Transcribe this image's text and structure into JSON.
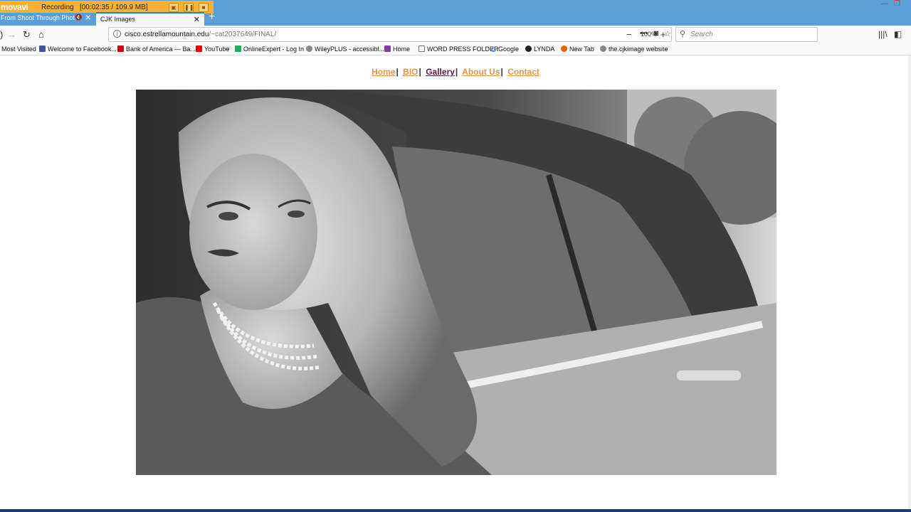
{
  "recorder": {
    "logo": "movavi",
    "status": "Recording",
    "time": "[00:02:35 / 109.9 MB]"
  },
  "tabs": [
    {
      "label": "From Shoot Through Photo",
      "active": false
    },
    {
      "label": "CJK Images",
      "active": true
    }
  ],
  "urlbar": {
    "host": "cisco.estrellamountain.edu",
    "path": "/~cat2037649/FINAL/",
    "zoom": "100%"
  },
  "search": {
    "placeholder": "Search"
  },
  "bookmarks": [
    {
      "label": "Most Visited",
      "icon": "none"
    },
    {
      "label": "Welcome to Facebook...",
      "icon": "facebook-icon",
      "color": "#3b5998"
    },
    {
      "label": "Bank of America — Ba...",
      "icon": "bofa-icon",
      "color": "#d4001a"
    },
    {
      "label": "YouTube",
      "icon": "youtube-icon",
      "color": "#e00"
    },
    {
      "label": "OnlineExpert - Log In",
      "icon": "onlineexpert-icon",
      "color": "#2a6"
    },
    {
      "label": "WileyPLUS - accessibl...",
      "icon": "globe-icon",
      "color": "#888"
    },
    {
      "label": "Home",
      "icon": "home-bm-icon",
      "color": "#7b3f9c"
    },
    {
      "label": "WORD PRESS FOLDER",
      "icon": "folder-icon",
      "color": "#999"
    },
    {
      "label": "Google",
      "icon": "google-icon",
      "color": "#4285f4"
    },
    {
      "label": "LYNDA",
      "icon": "lynda-icon",
      "color": "#222"
    },
    {
      "label": "New Tab",
      "icon": "firefox-icon",
      "color": "#e66000"
    },
    {
      "label": "the.cjkimage website",
      "icon": "globe-icon",
      "color": "#888"
    }
  ],
  "site_nav": [
    {
      "label": "Home",
      "visited": false
    },
    {
      "label": "BIO",
      "visited": false
    },
    {
      "label": "Gallery",
      "visited": true
    },
    {
      "label": "About Us",
      "visited": false
    },
    {
      "label": "Contact",
      "visited": false
    }
  ],
  "nav_separator": "|"
}
